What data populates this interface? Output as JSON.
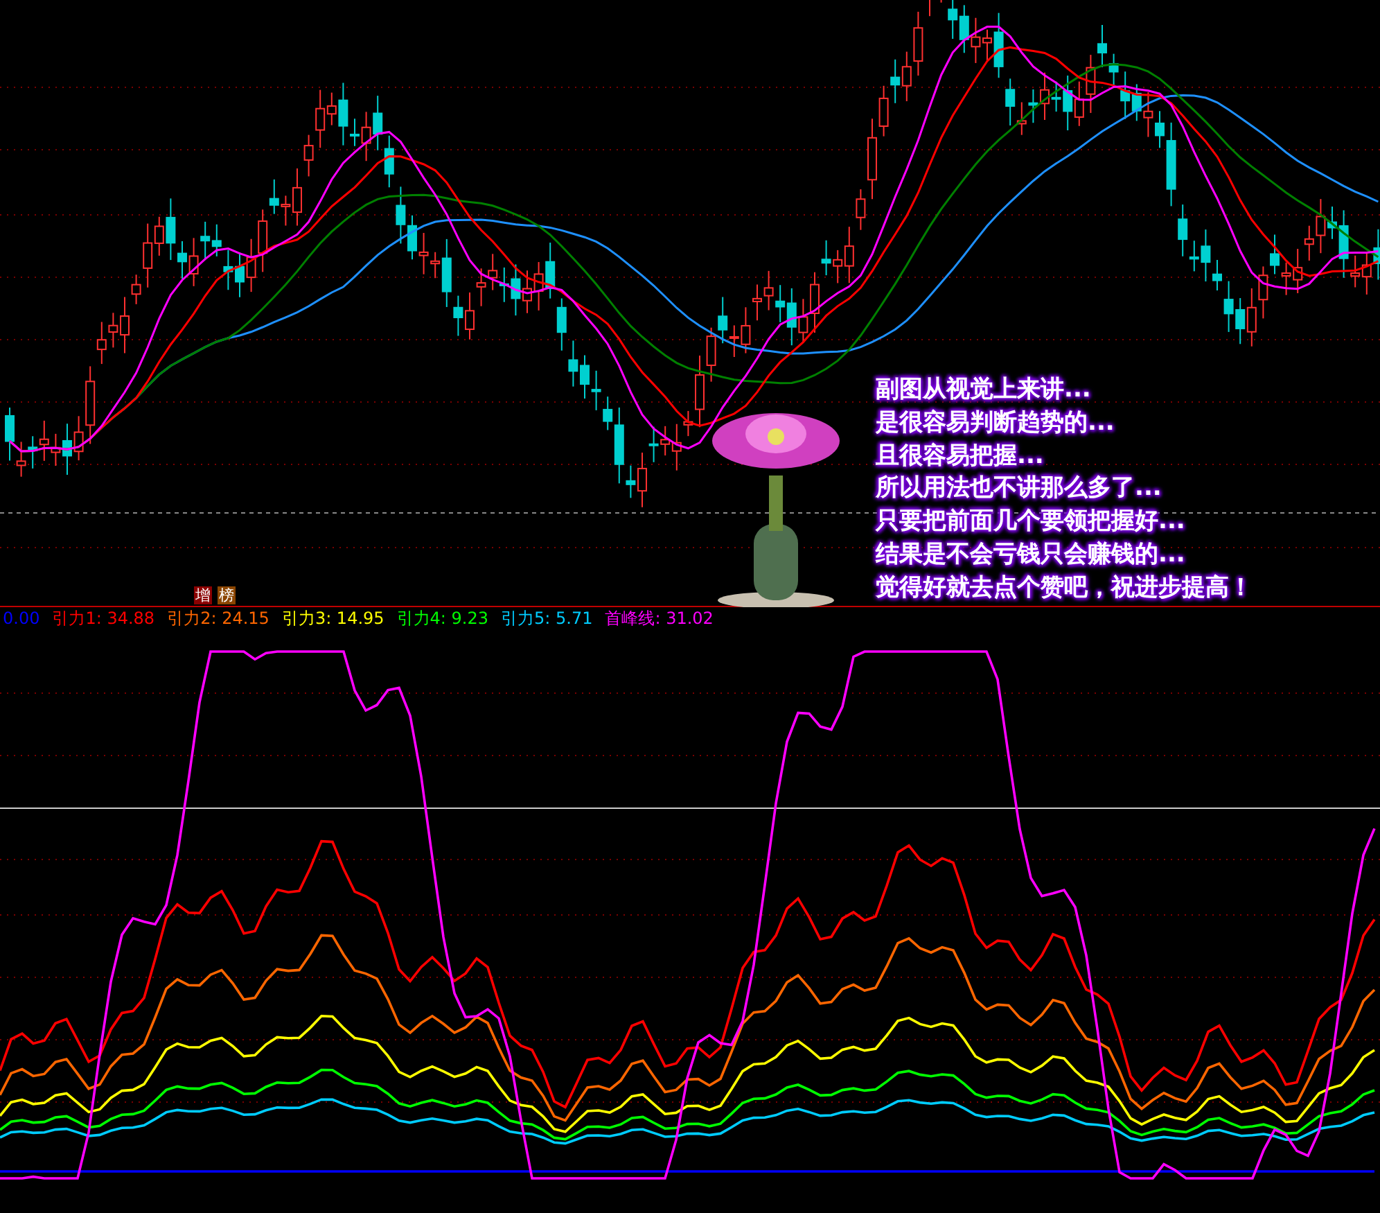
{
  "main_chart": {
    "tags": [
      {
        "label": "增",
        "color": "#8b0000"
      },
      {
        "label": "榜",
        "color": "#8b4500"
      }
    ]
  },
  "overlay_text": {
    "lines": [
      "副图从视觉上来讲...",
      "是很容易判断趋势的...",
      "且很容易把握...",
      "所以用法也不讲那么多了...",
      "只要把前面几个要领把握好...",
      "结果是不会亏钱只会赚钱的...",
      "觉得好就去点个赞吧，祝进步提高！"
    ]
  },
  "indicator": {
    "legend": [
      {
        "label": "0.00",
        "color": "#0000ff"
      },
      {
        "label": "引力1: 34.88",
        "color": "#ff0000"
      },
      {
        "label": "引力2: 24.15",
        "color": "#ff6600"
      },
      {
        "label": "引力3: 14.95",
        "color": "#ffff00"
      },
      {
        "label": "引力4: 9.23",
        "color": "#00ff00"
      },
      {
        "label": "引力5: 5.71",
        "color": "#00ccff"
      },
      {
        "label": "首峰线: 31.02",
        "color": "#ff00ff"
      }
    ]
  }
}
